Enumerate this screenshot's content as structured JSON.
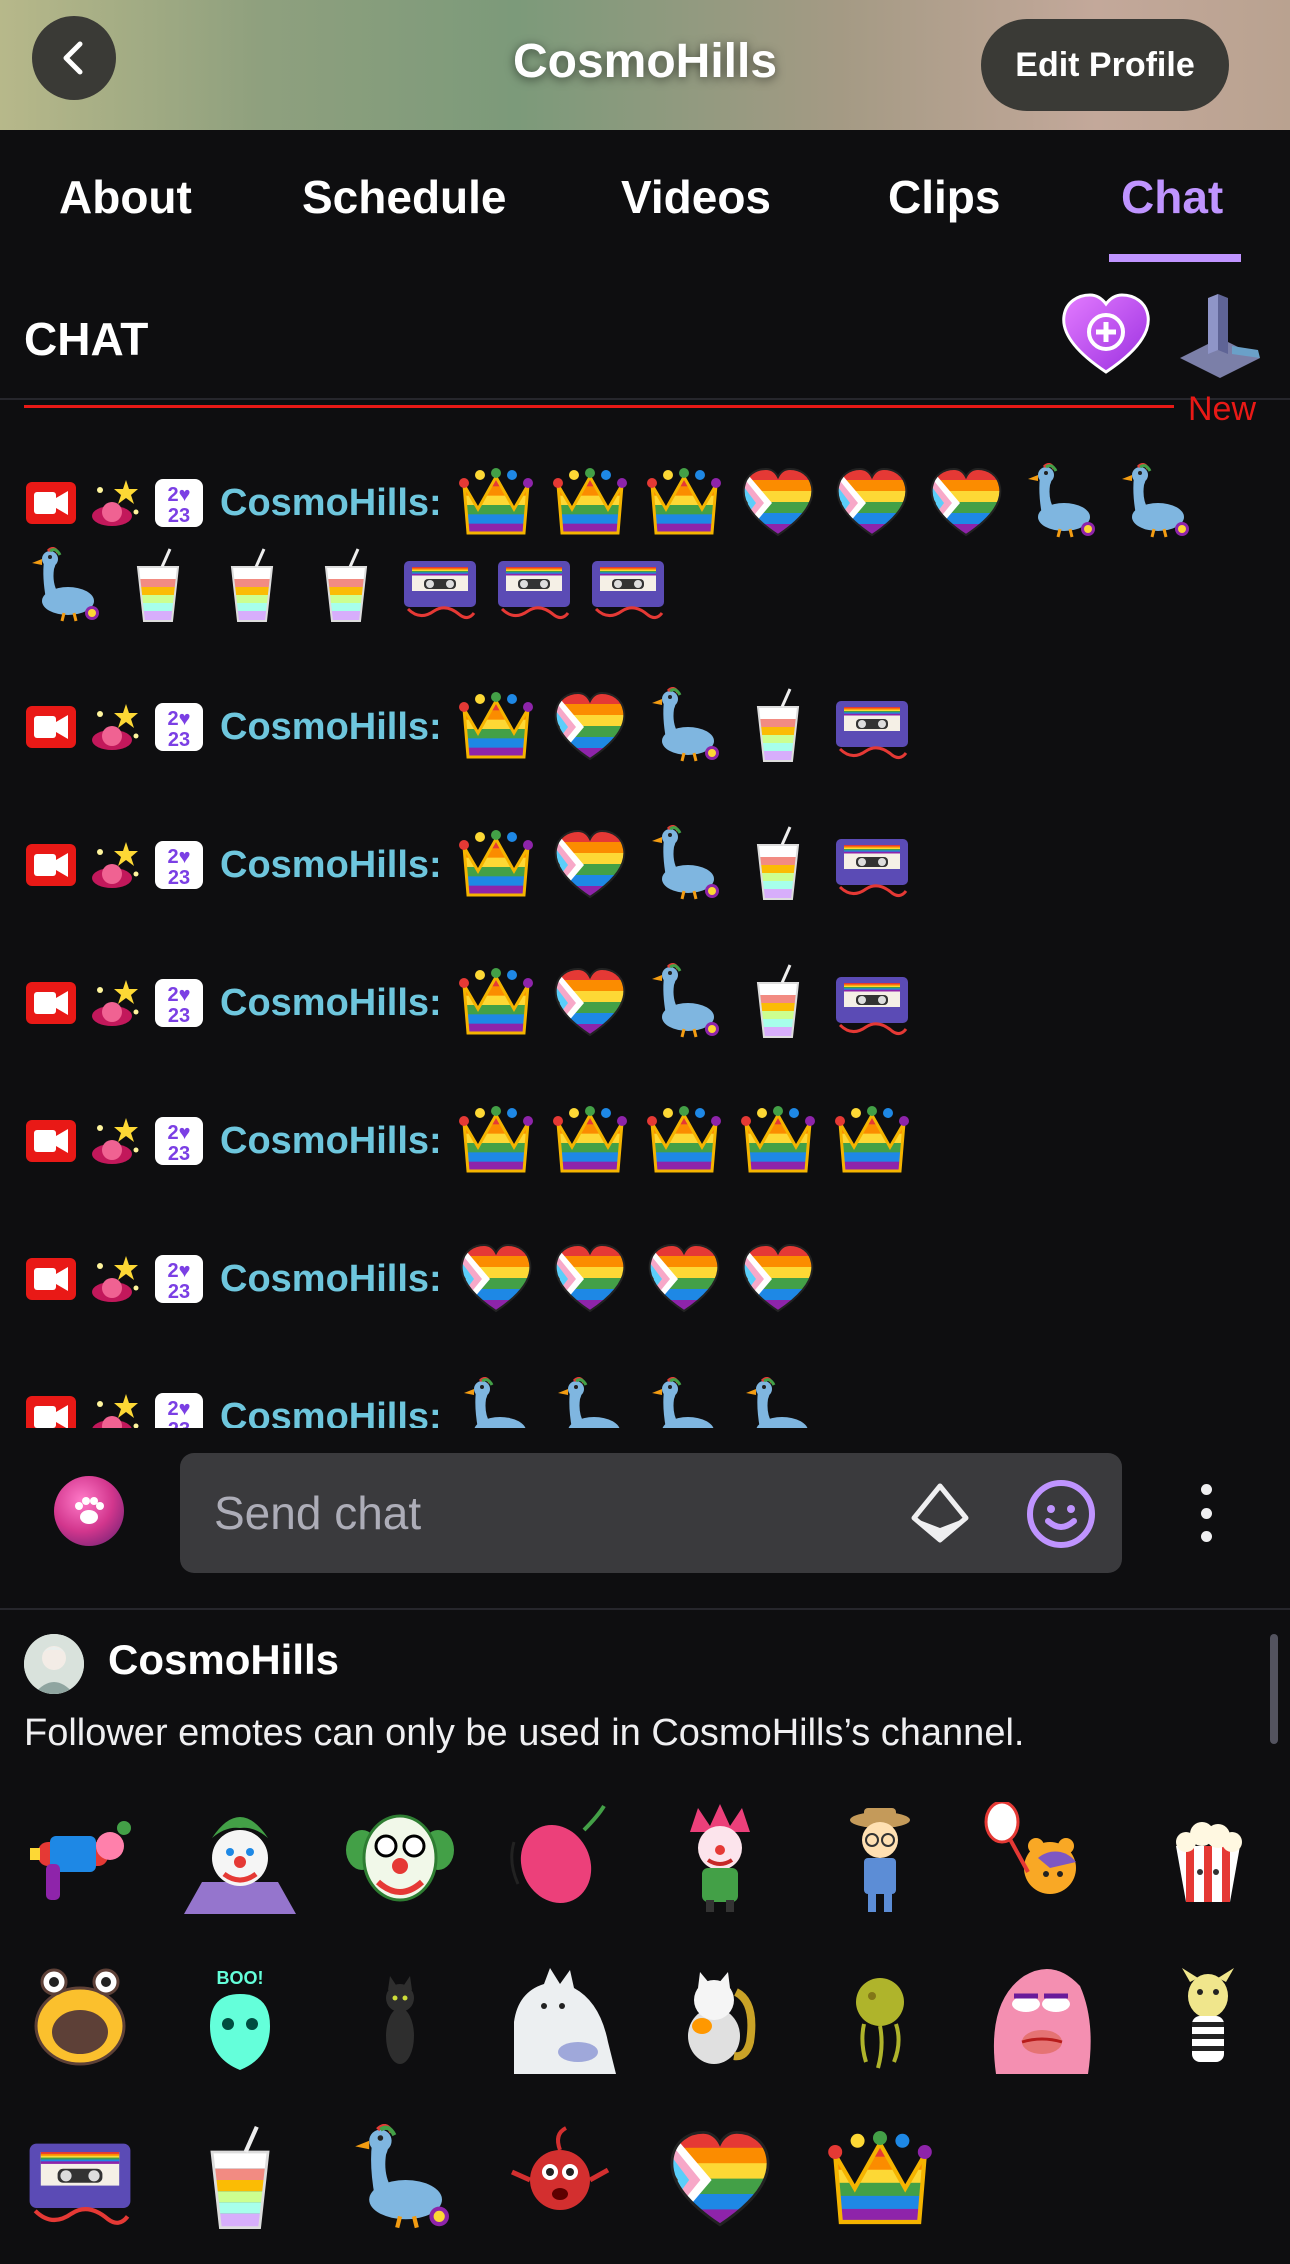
{
  "header": {
    "title": "CosmoHills",
    "edit_label": "Edit Profile",
    "background_colors": [
      "#b7b88a",
      "#7c9a7a",
      "#c3a89a"
    ]
  },
  "tabs": [
    {
      "label": "About",
      "active": false
    },
    {
      "label": "Schedule",
      "active": false
    },
    {
      "label": "Videos",
      "active": false
    },
    {
      "label": "Clips",
      "active": false
    },
    {
      "label": "Chat",
      "active": true
    }
  ],
  "chat": {
    "title": "CHAT",
    "new_label": "New",
    "username_color": "#6ec6dd",
    "accent": "#bf94ff",
    "messages": [
      {
        "user": "CosmoHills:",
        "emotes": [
          "crown",
          "crown",
          "crown",
          "pride-heart",
          "pride-heart",
          "pride-heart",
          "goose",
          "goose",
          "goose",
          "rainbow-cup",
          "rainbow-cup",
          "rainbow-cup",
          "cassette",
          "cassette",
          "cassette"
        ]
      },
      {
        "user": "CosmoHills:",
        "emotes": [
          "crown",
          "pride-heart",
          "goose",
          "rainbow-cup",
          "cassette"
        ]
      },
      {
        "user": "CosmoHills:",
        "emotes": [
          "crown",
          "pride-heart",
          "goose",
          "rainbow-cup",
          "cassette"
        ]
      },
      {
        "user": "CosmoHills:",
        "emotes": [
          "crown",
          "pride-heart",
          "goose",
          "rainbow-cup",
          "cassette"
        ]
      },
      {
        "user": "CosmoHills:",
        "emotes": [
          "crown",
          "crown",
          "crown",
          "crown",
          "crown"
        ]
      },
      {
        "user": "CosmoHills:",
        "emotes": [
          "pride-heart",
          "pride-heart",
          "pride-heart",
          "pride-heart"
        ]
      },
      {
        "user": "CosmoHills:",
        "emotes": [
          "goose",
          "goose",
          "goose",
          "goose"
        ]
      }
    ]
  },
  "composer": {
    "placeholder": "Send chat"
  },
  "emote_panel": {
    "channel": "CosmoHills",
    "note": "Follower emotes can only be used in CosmoHills’s channel.",
    "emotes": [
      "raygun",
      "clown-purple",
      "clown-green",
      "pink-balloon",
      "clown-pink",
      "farmer-kid",
      "bear-net",
      "popcorn",
      "yellow-monster",
      "boo-ghost",
      "black-cat",
      "white-cat",
      "cat-sax",
      "jellyfish",
      "pink-lips",
      "zebra",
      "cassette",
      "rainbow-cup",
      "goose",
      "red-creature",
      "pride-heart",
      "crown"
    ]
  }
}
